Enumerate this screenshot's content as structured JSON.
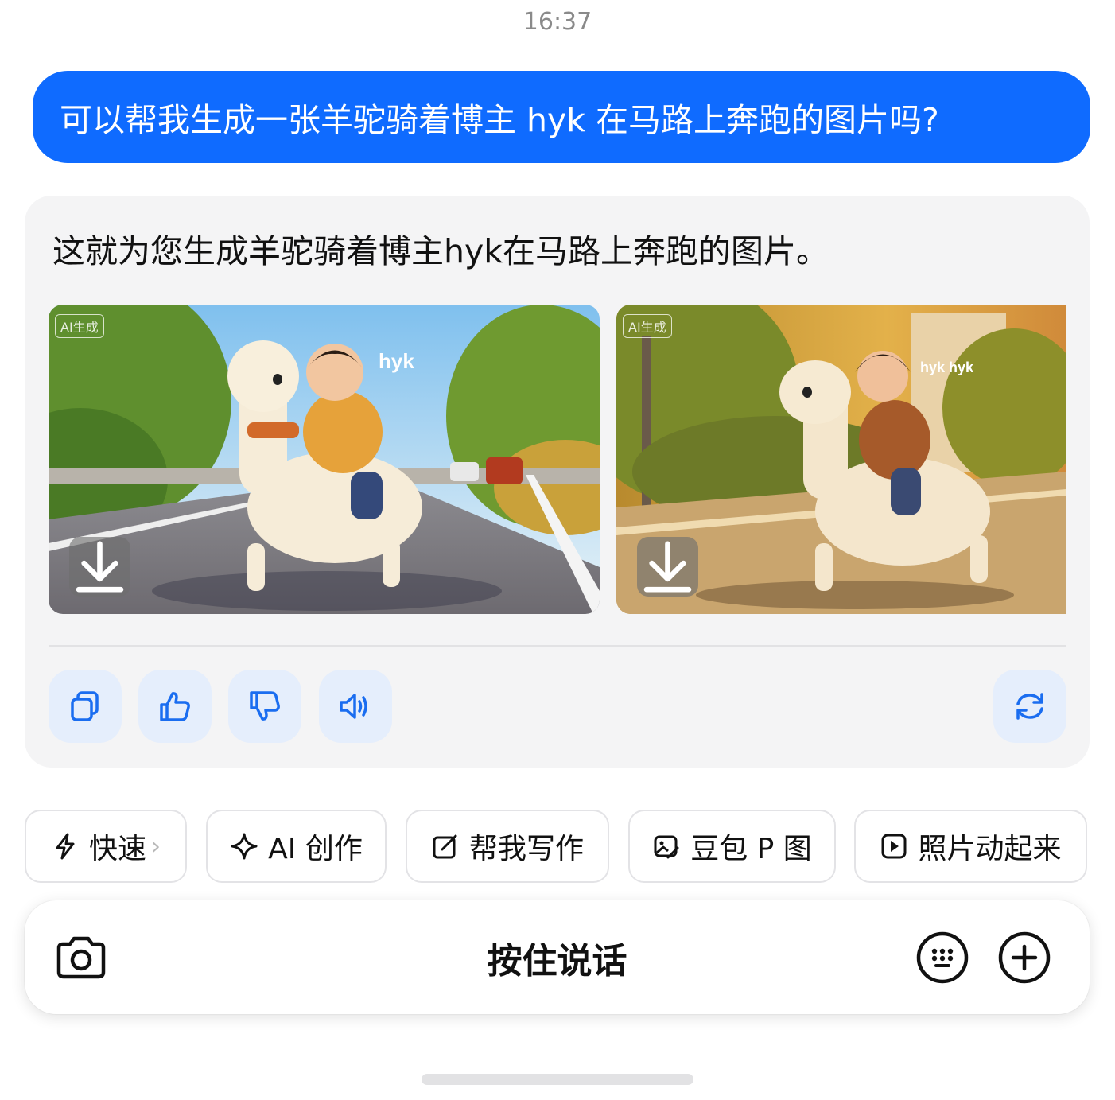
{
  "status": {
    "time": "16:37"
  },
  "conversation": {
    "user_message": "可以帮我生成一张羊驼骑着博主 hyk 在马路上奔跑的图片吗?",
    "assistant_message": "这就为您生成羊驼骑着博主hyk在马路上奔跑的图片。",
    "images": [
      {
        "tag": "AI生成",
        "caption_text": "hyk",
        "icon": "download-icon"
      },
      {
        "tag": "AI生成",
        "caption_text": "hyk hyk",
        "icon": "download-icon"
      }
    ],
    "actions": [
      "copy-icon",
      "thumbs-up-icon",
      "thumbs-down-icon",
      "speaker-icon",
      "regenerate-icon"
    ]
  },
  "quick_chips": [
    {
      "label": "快速",
      "icon": "lightning-icon",
      "chevron": "›"
    },
    {
      "label": "AI 创作",
      "icon": "sparkle-icon"
    },
    {
      "label": "帮我写作",
      "icon": "edit-icon"
    },
    {
      "label": "豆包 P 图",
      "icon": "image-edit-icon"
    },
    {
      "label": "照片动起来",
      "icon": "play-icon"
    }
  ],
  "input_bar": {
    "label": "按住说话",
    "left_icon": "camera-icon",
    "right_icons": [
      "keyboard-icon",
      "add-icon"
    ]
  },
  "colors": {
    "accent": "#0f6bff",
    "card_bg": "#f4f4f5",
    "action_bg": "#e5eefc",
    "action_icon": "#1a6df0"
  }
}
